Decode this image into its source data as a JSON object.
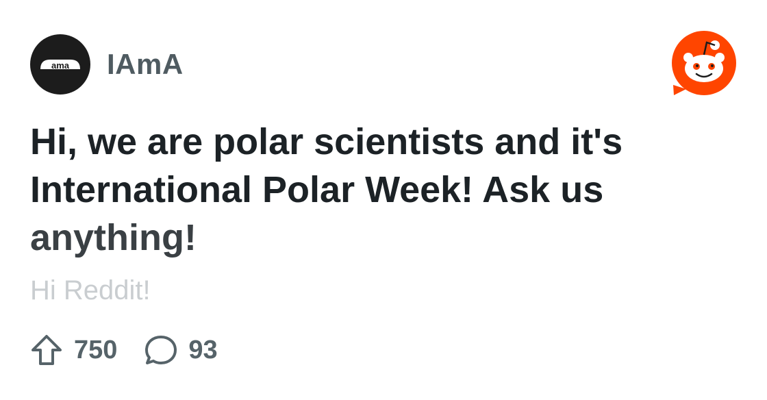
{
  "post": {
    "subreddit": "IAmA",
    "avatar_text": "ama",
    "title_line1": "Hi, we are polar scientists and it's",
    "title_line2": "International Polar Week! Ask us",
    "title_line3": "anything!",
    "snippet": "Hi Reddit!",
    "upvotes": "750",
    "comments": "93"
  },
  "icons": {
    "upvote": "upvote-arrow-icon",
    "comment": "comment-bubble-icon",
    "brand": "reddit-snoo-logo"
  },
  "colors": {
    "brand_orange": "#ff4500",
    "title": "#1c2226",
    "subreddit": "#4f5b61",
    "stats": "#566369",
    "snippet": "#c9cdd0"
  }
}
